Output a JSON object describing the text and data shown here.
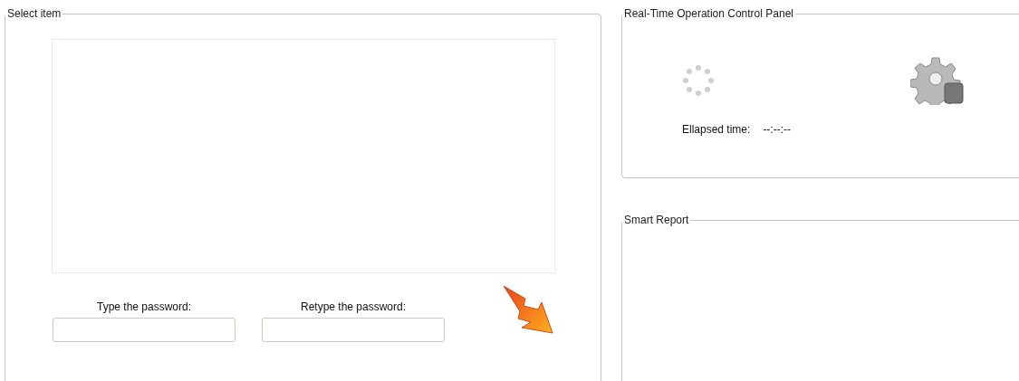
{
  "select_item": {
    "title": "Select item",
    "password_fields": [
      {
        "label": "Type the password:"
      },
      {
        "label": "Retype the password:"
      }
    ]
  },
  "control_panel": {
    "title": "Real-Time Operation Control Panel",
    "elapsed_label": "Ellapsed time:",
    "elapsed_value": "--:--:--"
  },
  "smart_report": {
    "title": "Smart Report"
  }
}
